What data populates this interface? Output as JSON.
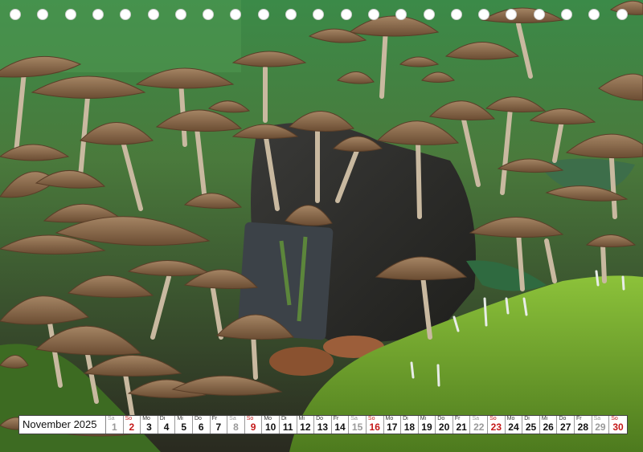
{
  "calendar": {
    "month_label": "November 2025",
    "days": [
      {
        "wd": "Sa",
        "n": "1",
        "type": "sat"
      },
      {
        "wd": "So",
        "n": "2",
        "type": "sun"
      },
      {
        "wd": "Mo",
        "n": "3",
        "type": "wk"
      },
      {
        "wd": "Di",
        "n": "4",
        "type": "wk"
      },
      {
        "wd": "Mi",
        "n": "5",
        "type": "wk"
      },
      {
        "wd": "Do",
        "n": "6",
        "type": "wk"
      },
      {
        "wd": "Fr",
        "n": "7",
        "type": "wk"
      },
      {
        "wd": "Sa",
        "n": "8",
        "type": "sat"
      },
      {
        "wd": "So",
        "n": "9",
        "type": "sun"
      },
      {
        "wd": "Mo",
        "n": "10",
        "type": "wk"
      },
      {
        "wd": "Di",
        "n": "11",
        "type": "wk"
      },
      {
        "wd": "Mi",
        "n": "12",
        "type": "wk"
      },
      {
        "wd": "Do",
        "n": "13",
        "type": "wk"
      },
      {
        "wd": "Fr",
        "n": "14",
        "type": "wk"
      },
      {
        "wd": "Sa",
        "n": "15",
        "type": "sat"
      },
      {
        "wd": "So",
        "n": "16",
        "type": "sun"
      },
      {
        "wd": "Mo",
        "n": "17",
        "type": "wk"
      },
      {
        "wd": "Di",
        "n": "18",
        "type": "wk"
      },
      {
        "wd": "Mi",
        "n": "19",
        "type": "wk"
      },
      {
        "wd": "Do",
        "n": "20",
        "type": "wk"
      },
      {
        "wd": "Fr",
        "n": "21",
        "type": "wk"
      },
      {
        "wd": "Sa",
        "n": "22",
        "type": "sat"
      },
      {
        "wd": "So",
        "n": "23",
        "type": "sun"
      },
      {
        "wd": "Mo",
        "n": "24",
        "type": "wk"
      },
      {
        "wd": "Di",
        "n": "25",
        "type": "wk"
      },
      {
        "wd": "Mi",
        "n": "26",
        "type": "wk"
      },
      {
        "wd": "Do",
        "n": "27",
        "type": "wk"
      },
      {
        "wd": "Fr",
        "n": "28",
        "type": "wk"
      },
      {
        "wd": "Sa",
        "n": "29",
        "type": "sat"
      },
      {
        "wd": "So",
        "n": "30",
        "type": "sun"
      }
    ]
  },
  "binding": {
    "hole_count": 23,
    "hole_color": "#ffffff"
  },
  "colors": {
    "sunday": "#c41818",
    "saturday": "#999999",
    "moss": "#5f8f2a",
    "cap": "#8a6a48",
    "background_green": "#3f7a3a"
  }
}
